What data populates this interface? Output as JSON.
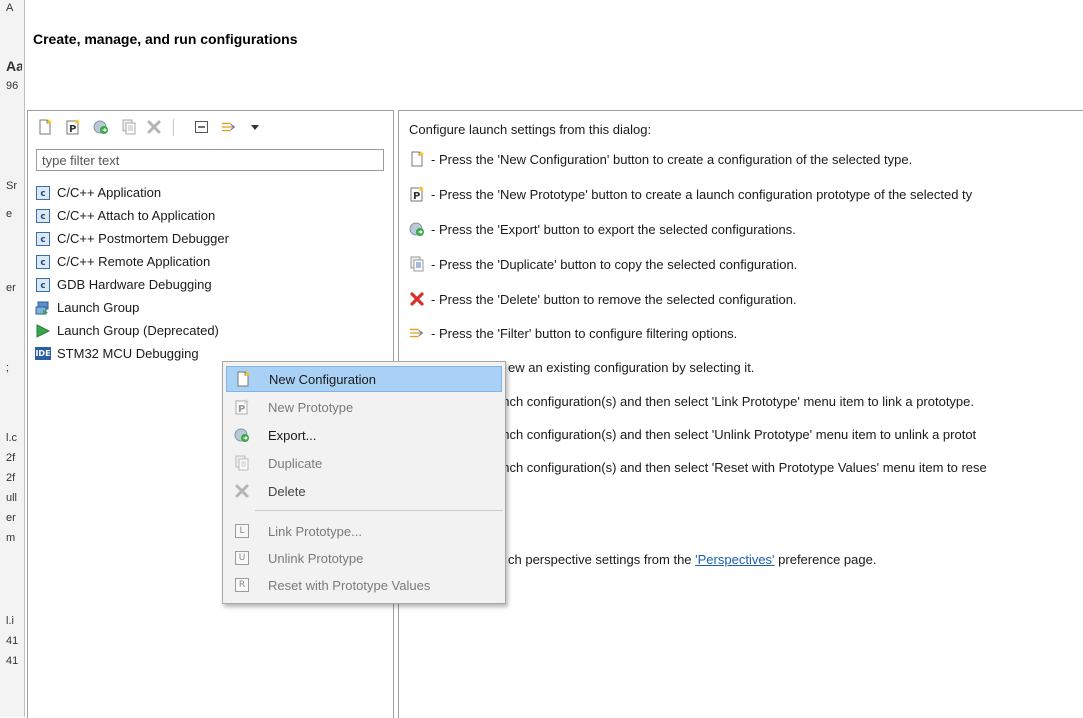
{
  "background_fragments": [
    "A",
    "Aa",
    "96",
    "Sr",
    "e",
    "er",
    ";",
    "l.c",
    "2f",
    "2f",
    "ull",
    "er",
    "m",
    "l.i",
    "41",
    "41"
  ],
  "dialog": {
    "title": "Create, manage, and run configurations"
  },
  "toolbar": {
    "icons": [
      "new-configuration-icon",
      "new-prototype-icon",
      "export-icon",
      "duplicate-icon",
      "delete-icon",
      "collapse-all-icon",
      "filter-icon",
      "dropdown-arrow-icon"
    ]
  },
  "filter": {
    "placeholder": "type filter text",
    "value": ""
  },
  "tree": {
    "items": [
      {
        "label": "C/C++ Application",
        "icon": "c-icon"
      },
      {
        "label": "C/C++ Attach to Application",
        "icon": "c-icon"
      },
      {
        "label": "C/C++ Postmortem Debugger",
        "icon": "c-icon"
      },
      {
        "label": "C/C++ Remote Application",
        "icon": "c-icon"
      },
      {
        "label": "GDB Hardware Debugging",
        "icon": "c-icon"
      },
      {
        "label": "Launch Group",
        "icon": "launch-group-icon"
      },
      {
        "label": "Launch Group (Deprecated)",
        "icon": "launch-group-deprecated-icon"
      },
      {
        "label": "STM32 MCU Debugging",
        "icon": "ide-icon",
        "ide_text": "IDE"
      }
    ]
  },
  "info": {
    "heading": "Configure launch settings from this dialog:",
    "lines": [
      "- Press the 'New Configuration' button to create a configuration of the selected type.",
      "- Press the 'New Prototype' button to create a launch configuration prototype of the selected ty",
      "- Press the 'Export' button to export the selected configurations.",
      "- Press the 'Duplicate' button to copy the selected configuration.",
      "- Press the 'Delete' button to remove the selected configuration.",
      "- Press the 'Filter' button to configure filtering options.",
      "ew an existing configuration by selecting it.",
      "unch configuration(s) and then select 'Link Prototype' menu item to link a prototype.",
      "unch configuration(s) and then select 'Unlink Prototype' menu item to unlink a protot",
      "unch configuration(s) and then select 'Reset with Prototype Values' menu item to rese"
    ],
    "perspective_prefix": "ch perspective settings from the ",
    "perspective_link": "'Perspectives'",
    "perspective_suffix": " preference page."
  },
  "context_menu": {
    "items": [
      {
        "label": "New Configuration",
        "enabled": true,
        "selected": true
      },
      {
        "label": "New Prototype",
        "enabled": false
      },
      {
        "label": "Export...",
        "enabled": true
      },
      {
        "label": "Duplicate",
        "enabled": false
      },
      {
        "label": "Delete",
        "enabled": true
      },
      {
        "label": "Link Prototype...",
        "enabled": false,
        "icon_letter": "L"
      },
      {
        "label": "Unlink Prototype",
        "enabled": false,
        "icon_letter": "U"
      },
      {
        "label": "Reset with Prototype Values",
        "enabled": false,
        "icon_letter": "R"
      }
    ]
  },
  "colors": {
    "selection": "#a9d1f5",
    "link": "#1a5fb4",
    "delete_red": "#d9302c",
    "launch_green": "#3aa64a"
  }
}
